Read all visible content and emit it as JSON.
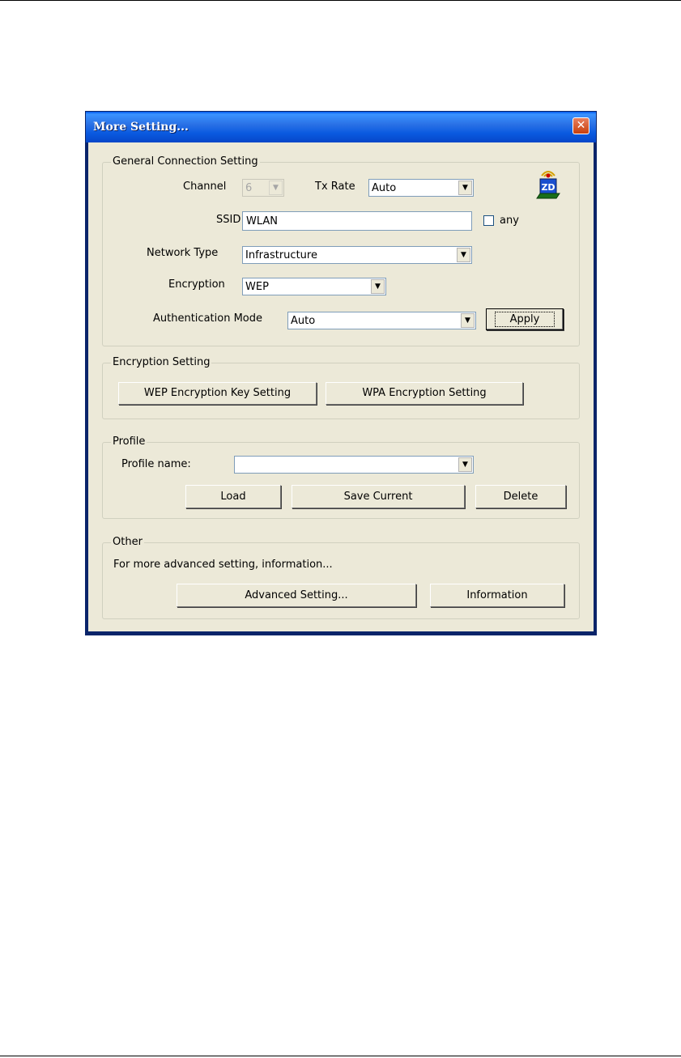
{
  "window": {
    "title": "More Setting...",
    "close_glyph": "✕"
  },
  "general": {
    "legend": "General Connection Setting",
    "channel_label": "Channel",
    "channel_value": "6",
    "txrate_label": "Tx Rate",
    "txrate_value": "Auto",
    "ssid_label": "SSID",
    "ssid_value": "WLAN",
    "any_label": "any",
    "network_type_label": "Network Type",
    "network_type_value": "Infrastructure",
    "encryption_label": "Encryption",
    "encryption_value": "WEP",
    "auth_mode_label": "Authentication Mode",
    "auth_mode_value": "Auto",
    "apply_label": "Apply",
    "icon_text": "ZD"
  },
  "encryption_setting": {
    "legend": "Encryption Setting",
    "wep_button": "WEP Encryption Key Setting",
    "wpa_button": "WPA Encryption Setting"
  },
  "profile": {
    "legend": "Profile",
    "name_label": "Profile name:",
    "name_value": "",
    "load_button": "Load",
    "save_button": "Save Current",
    "delete_button": "Delete"
  },
  "other": {
    "legend": "Other",
    "info_text": "For more advanced setting, information...",
    "advanced_button": "Advanced Setting...",
    "information_button": "Information"
  },
  "icons": {
    "close": "close-icon",
    "dropdown": "chevron-down-icon",
    "app": "wireless-adapter-icon"
  },
  "colors": {
    "titlebar": "#0a5ae0",
    "dialog_bg": "#ece9d8",
    "close_button": "#c8400d"
  }
}
